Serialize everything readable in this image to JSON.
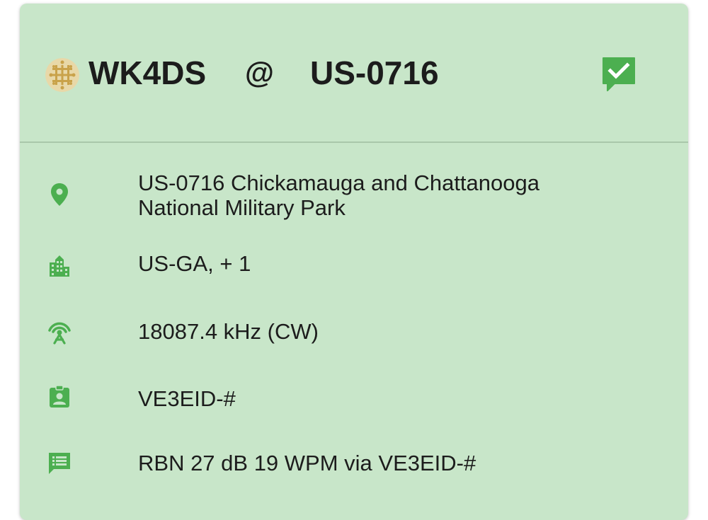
{
  "colors": {
    "card_background": "#c8e6c9",
    "icon_green": "#4caf50",
    "text": "#1c1c1c",
    "avatar_gold": "#c9a24a"
  },
  "header": {
    "callsign": "WK4DS",
    "at_symbol": "@",
    "park_reference": "US-0716",
    "status_icon": "check-comment-icon"
  },
  "details": {
    "park": {
      "icon": "location-pin-icon",
      "line1": "US-0716  Chickamauga and Chattanooga",
      "line2": "National Military Park"
    },
    "location": {
      "icon": "city-building-icon",
      "text": "US-GA, + 1"
    },
    "frequency": {
      "icon": "antenna-icon",
      "text": "18087.4 kHz (CW)"
    },
    "spotter": {
      "icon": "contact-badge-icon",
      "text": "VE3EID-#"
    },
    "comment": {
      "icon": "message-list-icon",
      "text": "RBN 27 dB 19 WPM via VE3EID-#"
    }
  }
}
